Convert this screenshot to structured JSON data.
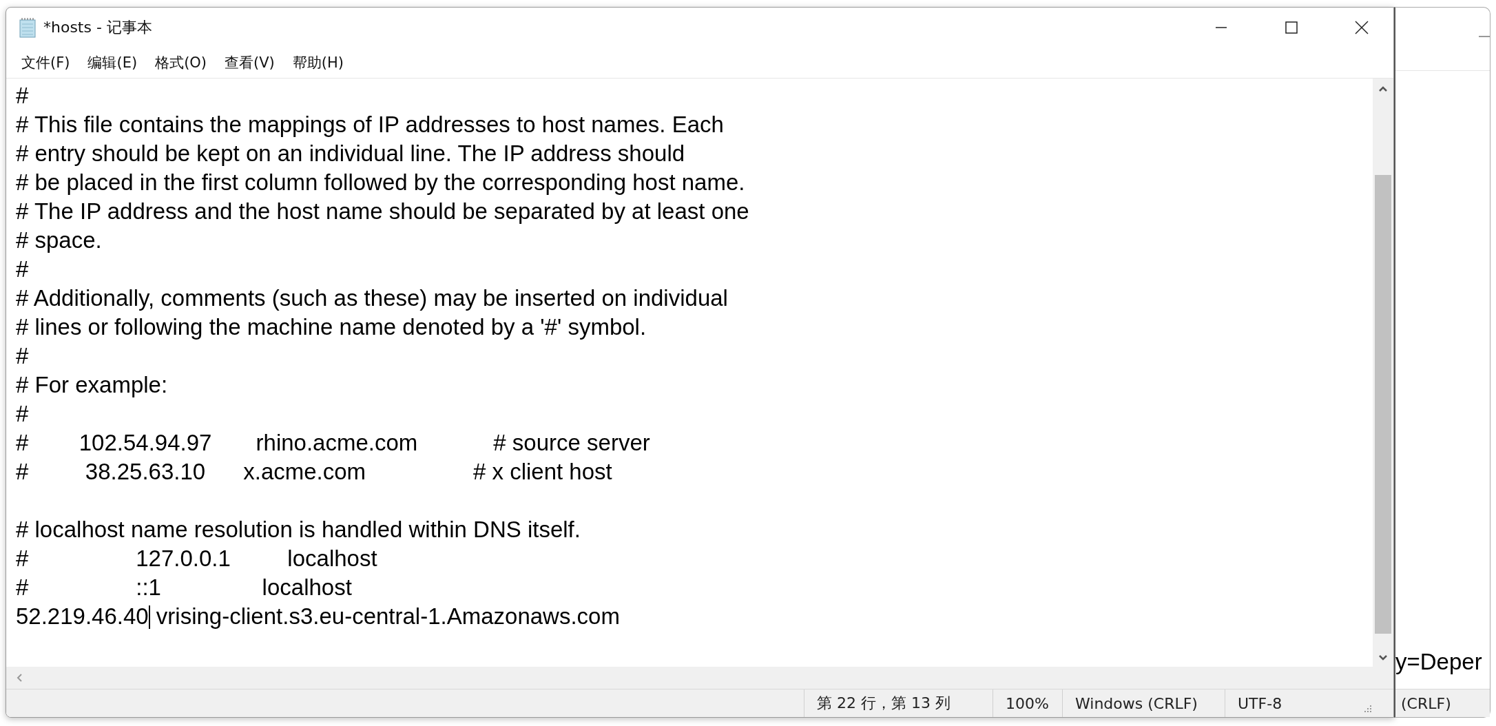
{
  "window": {
    "title": "*hosts - 记事本"
  },
  "menu": [
    "文件(F)",
    "编辑(E)",
    "格式(O)",
    "查看(V)",
    "帮助(H)"
  ],
  "editor": {
    "lines": [
      {
        "kind": "text",
        "text": "#"
      },
      {
        "kind": "text",
        "text": "# This file contains the mappings of IP addresses to host names. Each"
      },
      {
        "kind": "text",
        "text": "# entry should be kept on an individual line. The IP address should"
      },
      {
        "kind": "text",
        "text": "# be placed in the first column followed by the corresponding host name."
      },
      {
        "kind": "text",
        "text": "# The IP address and the host name should be separated by at least one"
      },
      {
        "kind": "text",
        "text": "# space."
      },
      {
        "kind": "text",
        "text": "#"
      },
      {
        "kind": "text",
        "text": "# Additionally, comments (such as these) may be inserted on individual"
      },
      {
        "kind": "text",
        "text": "# lines or following the machine name denoted by a '#' symbol."
      },
      {
        "kind": "text",
        "text": "#"
      },
      {
        "kind": "text",
        "text": "# For example:"
      },
      {
        "kind": "text",
        "text": "#"
      },
      {
        "kind": "text",
        "text": "#        102.54.94.97       rhino.acme.com            # source server"
      },
      {
        "kind": "text",
        "text": "#         38.25.63.10      x.acme.com                 # x client host"
      },
      {
        "kind": "blank"
      },
      {
        "kind": "text",
        "text": "# localhost name resolution is handled within DNS itself."
      },
      {
        "kind": "text",
        "text": "#                 127.0.0.1         localhost"
      },
      {
        "kind": "text",
        "text": "#                 ::1                localhost"
      },
      {
        "kind": "caret",
        "text": "52.219.46.40",
        "text_after_caret": " vrising-client.s3.eu-central-1.Amazonaws.com"
      }
    ]
  },
  "status_bar": {
    "position": "第 22 行，第 13 列",
    "zoom": "100%",
    "line_ending": "Windows (CRLF)",
    "encoding": "UTF-8"
  },
  "background_window": {
    "text": "y=Deper",
    "status": "(CRLF)"
  }
}
